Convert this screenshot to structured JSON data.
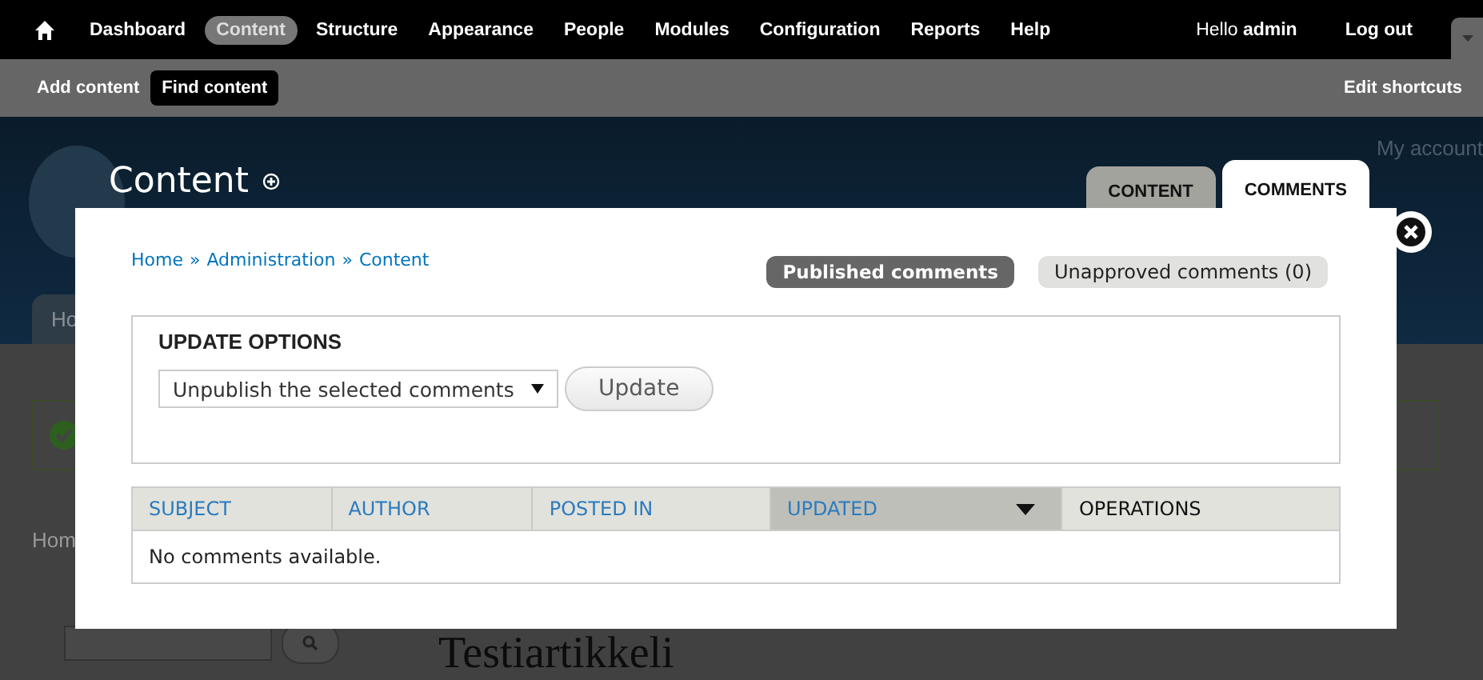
{
  "toolbar": {
    "menu": [
      {
        "label": "Dashboard",
        "selected": false
      },
      {
        "label": "Content",
        "selected": true
      },
      {
        "label": "Structure",
        "selected": false
      },
      {
        "label": "Appearance",
        "selected": false
      },
      {
        "label": "People",
        "selected": false
      },
      {
        "label": "Modules",
        "selected": false
      },
      {
        "label": "Configuration",
        "selected": false
      },
      {
        "label": "Reports",
        "selected": false
      },
      {
        "label": "Help",
        "selected": false
      }
    ],
    "greeting": "Hello **admin**",
    "logout": "Log out"
  },
  "shortcuts": {
    "items": [
      {
        "label": "Add content",
        "selected": false
      },
      {
        "label": "Find content",
        "selected": true
      }
    ],
    "edit": "Edit shortcuts"
  },
  "header": {
    "title": "Content",
    "account_link": "My account",
    "tabs": [
      {
        "label": "CONTENT",
        "selected": false
      },
      {
        "label": "COMMENTS",
        "selected": true
      }
    ]
  },
  "background": {
    "tab": "Ho",
    "breadcrumb": "Hom",
    "node_title": "Testiartikkeli"
  },
  "dialog": {
    "breadcrumb": {
      "links": [
        "Home",
        "Administration",
        "Content"
      ],
      "separators": [
        "»",
        "»"
      ]
    },
    "filters": [
      {
        "label": "Published comments",
        "selected": true
      },
      {
        "label": "Unapproved comments (0)",
        "selected": false
      }
    ],
    "update_options": {
      "legend": "UPDATE OPTIONS",
      "select_value": "Unpublish the selected comments",
      "button": "Update"
    },
    "table": {
      "columns": [
        {
          "label": "SUBJECT",
          "sortable": true,
          "sorted": false
        },
        {
          "label": "AUTHOR",
          "sortable": true,
          "sorted": false
        },
        {
          "label": "POSTED IN",
          "sortable": true,
          "sorted": false
        },
        {
          "label": "UPDATED",
          "sortable": true,
          "sorted": true
        },
        {
          "label": "OPERATIONS",
          "sortable": false,
          "sorted": false
        }
      ],
      "empty_text": "No comments available."
    }
  }
}
